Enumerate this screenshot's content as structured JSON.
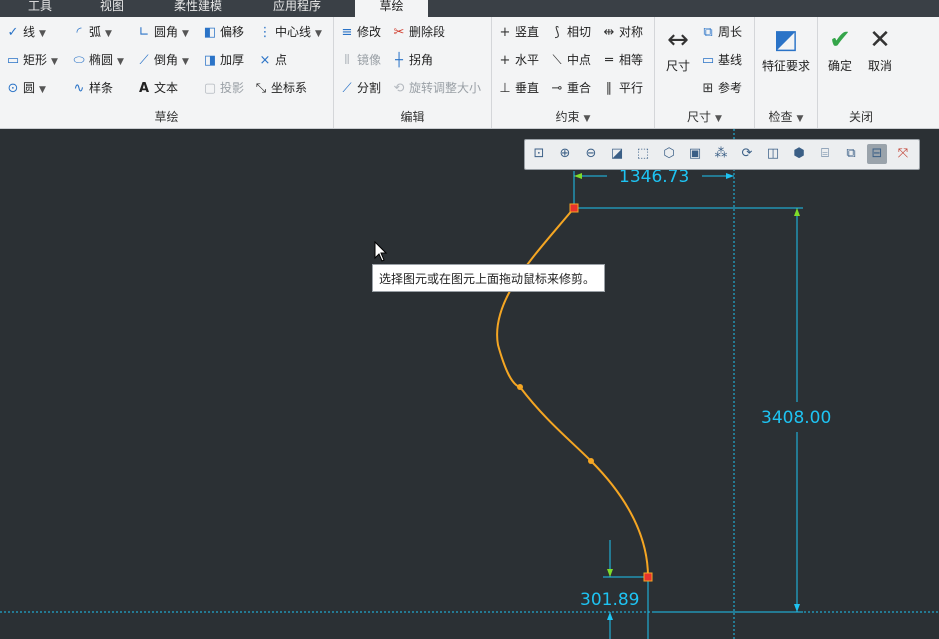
{
  "tabs": [
    {
      "label": "工具",
      "active": false
    },
    {
      "label": "视图",
      "active": false
    },
    {
      "label": "柔性建模",
      "active": false
    },
    {
      "label": "应用程序",
      "active": false
    },
    {
      "label": "草绘",
      "active": true
    }
  ],
  "groups": {
    "sketch": {
      "label": "草绘",
      "items": {
        "line": "线",
        "arc": "弧",
        "fillet": "圆角",
        "offset": "偏移",
        "centerline": "中心线",
        "rectangle": "矩形",
        "ellipse": "椭圆",
        "chamfer": "倒角",
        "thicken": "加厚",
        "point": "点",
        "circle": "圆",
        "spline": "样条",
        "text": "文本",
        "project": "投影",
        "coordsys": "坐标系"
      }
    },
    "edit": {
      "label": "编辑",
      "items": {
        "modify": "修改",
        "delete_segment": "删除段",
        "mirror": "镜像",
        "corner": "拐角",
        "divide": "分割",
        "rotate_resize": "旋转调整大小"
      }
    },
    "constrain": {
      "label": "约束",
      "items": {
        "vertical": "竖直",
        "tangent": "相切",
        "symmetric": "对称",
        "horizontal": "水平",
        "midpoint": "中点",
        "equal": "相等",
        "perpendicular": "垂直",
        "coincident": "重合",
        "parallel": "平行"
      }
    },
    "dimension": {
      "label": "尺寸",
      "items": {
        "dimension": "尺寸",
        "perimeter": "周长",
        "baseline": "基线",
        "reference": "参考"
      }
    },
    "inspect": {
      "label": "检查",
      "items": {
        "feature_req": "特征要求"
      }
    },
    "close": {
      "label": "关闭",
      "items": {
        "ok": "确定",
        "cancel": "取消"
      }
    }
  },
  "tooltip": "选择图元或在图元上面拖动鼠标来修剪。",
  "dimensions": {
    "horizontal": "1346.73",
    "vertical": "3408.00",
    "small": "301.89"
  },
  "colors": {
    "canvas": "#2b3034",
    "curve": "#f5a623",
    "dimension": "#1ec3f2",
    "endpoint": "#e8322d",
    "ribbon": "#f3f4f5"
  }
}
